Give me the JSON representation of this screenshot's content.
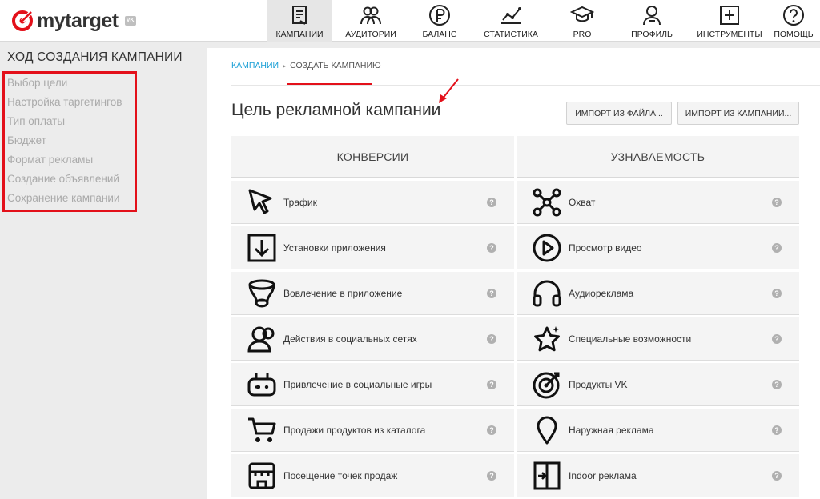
{
  "header": {
    "logo_text": "mytarget",
    "vk_badge": "VK",
    "nav": [
      {
        "label": "КАМПАНИИ",
        "icon": "campaigns-icon",
        "active": true
      },
      {
        "label": "АУДИТОРИИ",
        "icon": "audiences-icon",
        "active": false
      },
      {
        "label": "БАЛАНС",
        "icon": "ruble-icon",
        "active": false
      },
      {
        "label": "СТАТИСТИКА",
        "icon": "stats-icon",
        "active": false
      },
      {
        "label": "PRO",
        "icon": "graduation-cap-icon",
        "active": false
      },
      {
        "label": "ПРОФИЛЬ",
        "icon": "profile-icon",
        "active": false
      },
      {
        "label": "ИНСТРУМЕНТЫ",
        "icon": "tools-icon",
        "active": false
      },
      {
        "label": "ПОМОЩЬ",
        "icon": "help-icon",
        "active": false
      }
    ]
  },
  "sidebar": {
    "title": "ХОД СОЗДАНИЯ КАМПАНИИ",
    "steps": [
      "Выбор цели",
      "Настройка таргетингов",
      "Тип оплаты",
      "Бюджет",
      "Формат рекламы",
      "Создание объявлений",
      "Сохранение кампании"
    ]
  },
  "breadcrumb": {
    "link": "КАМПАНИИ",
    "separator": "▸",
    "current": "СОЗДАТЬ КАМПАНИЮ"
  },
  "page": {
    "title": "Цель рекламной кампании",
    "import_file_button": "ИМПОРТ ИЗ ФАЙЛА...",
    "import_campaign_button": "ИМПОРТ ИЗ КАМПАНИИ..."
  },
  "columns": {
    "left_header": "КОНВЕРСИИ",
    "right_header": "УЗНАВАЕМОСТЬ"
  },
  "goals_left": [
    {
      "label": "Трафик",
      "icon": "cursor-icon"
    },
    {
      "label": "Установки приложения",
      "icon": "download-box-icon"
    },
    {
      "label": "Вовлечение в приложение",
      "icon": "funnel-icon"
    },
    {
      "label": "Действия в социальных сетях",
      "icon": "social-people-icon"
    },
    {
      "label": "Привлечение в социальные игры",
      "icon": "gamepad-icon"
    },
    {
      "label": "Продажи продуктов из каталога",
      "icon": "cart-icon"
    },
    {
      "label": "Посещение точек продаж",
      "icon": "store-icon"
    }
  ],
  "goals_right": [
    {
      "label": "Охват",
      "icon": "network-icon"
    },
    {
      "label": "Просмотр видео",
      "icon": "play-icon"
    },
    {
      "label": "Аудиореклама",
      "icon": "headphones-icon"
    },
    {
      "label": "Специальные возможности",
      "icon": "star-icon"
    },
    {
      "label": "Продукты VK",
      "icon": "target-icon"
    },
    {
      "label": "Наружная реклама",
      "icon": "location-pin-icon"
    },
    {
      "label": "Indoor реклама",
      "icon": "door-icon"
    }
  ],
  "help_mark": "?",
  "colors": {
    "accent_red": "#e3101a",
    "link_blue": "#1a9fd6",
    "card_bg": "#f4f4f4",
    "sidebar_bg": "#ececec"
  }
}
